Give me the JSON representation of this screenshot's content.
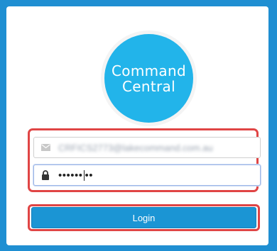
{
  "logo": {
    "line1": "Command",
    "line2": "Central"
  },
  "email": {
    "value": "CRFICS2773@lakecommand.com.au",
    "icon": "envelope-icon"
  },
  "password": {
    "masked_before_caret": "••••••",
    "masked_after_caret": "••",
    "icon": "lock-icon"
  },
  "login": {
    "label": "Login"
  },
  "colors": {
    "background": "#1f8fd2",
    "logo": "#22b4ea",
    "button": "#1b95d4",
    "highlight": "#e04545"
  }
}
